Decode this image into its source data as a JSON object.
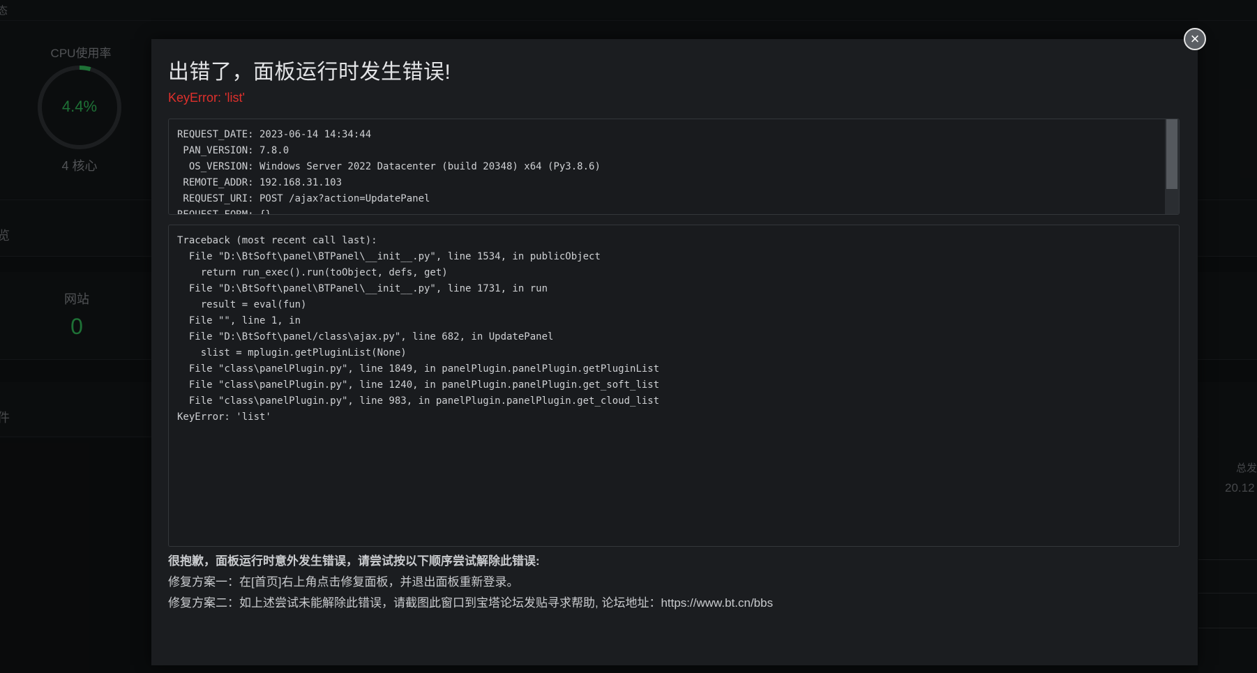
{
  "background": {
    "topbar_fragment": "态",
    "cpu": {
      "title": "CPU使用率",
      "value": "4.4%",
      "percent": 4.4,
      "cores": "4 核心"
    },
    "section_overview": "览",
    "sites": {
      "label": "网站",
      "count": "0"
    },
    "section_software": "件",
    "right_label": "总发",
    "right_value": "20.12"
  },
  "modal": {
    "close_symbol": "×",
    "title": "出错了，面板运行时发生错误!",
    "error": "KeyError: 'list'",
    "request_info": "REQUEST_DATE: 2023-06-14 14:34:44\n PAN_VERSION: 7.8.0\n  OS_VERSION: Windows Server 2022 Datacenter (build 20348) x64 (Py3.8.6)\n REMOTE_ADDR: 192.168.31.103\n REQUEST_URI: POST /ajax?action=UpdatePanel\nREQUEST_FORM: {}",
    "traceback": "Traceback (most recent call last):\n  File \"D:\\BtSoft\\panel\\BTPanel\\__init__.py\", line 1534, in publicObject\n    return run_exec().run(toObject, defs, get)\n  File \"D:\\BtSoft\\panel\\BTPanel\\__init__.py\", line 1731, in run\n    result = eval(fun)\n  File \"\", line 1, in \n  File \"D:\\BtSoft\\panel/class\\ajax.py\", line 682, in UpdatePanel\n    slist = mplugin.getPluginList(None)\n  File \"class\\panelPlugin.py\", line 1849, in panelPlugin.panelPlugin.getPluginList\n  File \"class\\panelPlugin.py\", line 1240, in panelPlugin.panelPlugin.get_soft_list\n  File \"class\\panelPlugin.py\", line 983, in panelPlugin.panelPlugin.get_cloud_list\nKeyError: 'list'",
    "help_title": "很抱歉，面板运行时意外发生错误，请尝试按以下顺序尝试解除此错误:",
    "fix_one": "修复方案一：在[首页]右上角点击修复面板，并退出面板重新登录。",
    "fix_two": "修复方案二：如上述尝试未能解除此错误，请截图此窗口到宝塔论坛发贴寻求帮助, 论坛地址：https://www.bt.cn/bbs"
  },
  "colors": {
    "accent_green": "#2eae53",
    "error_red": "#e0302c"
  }
}
